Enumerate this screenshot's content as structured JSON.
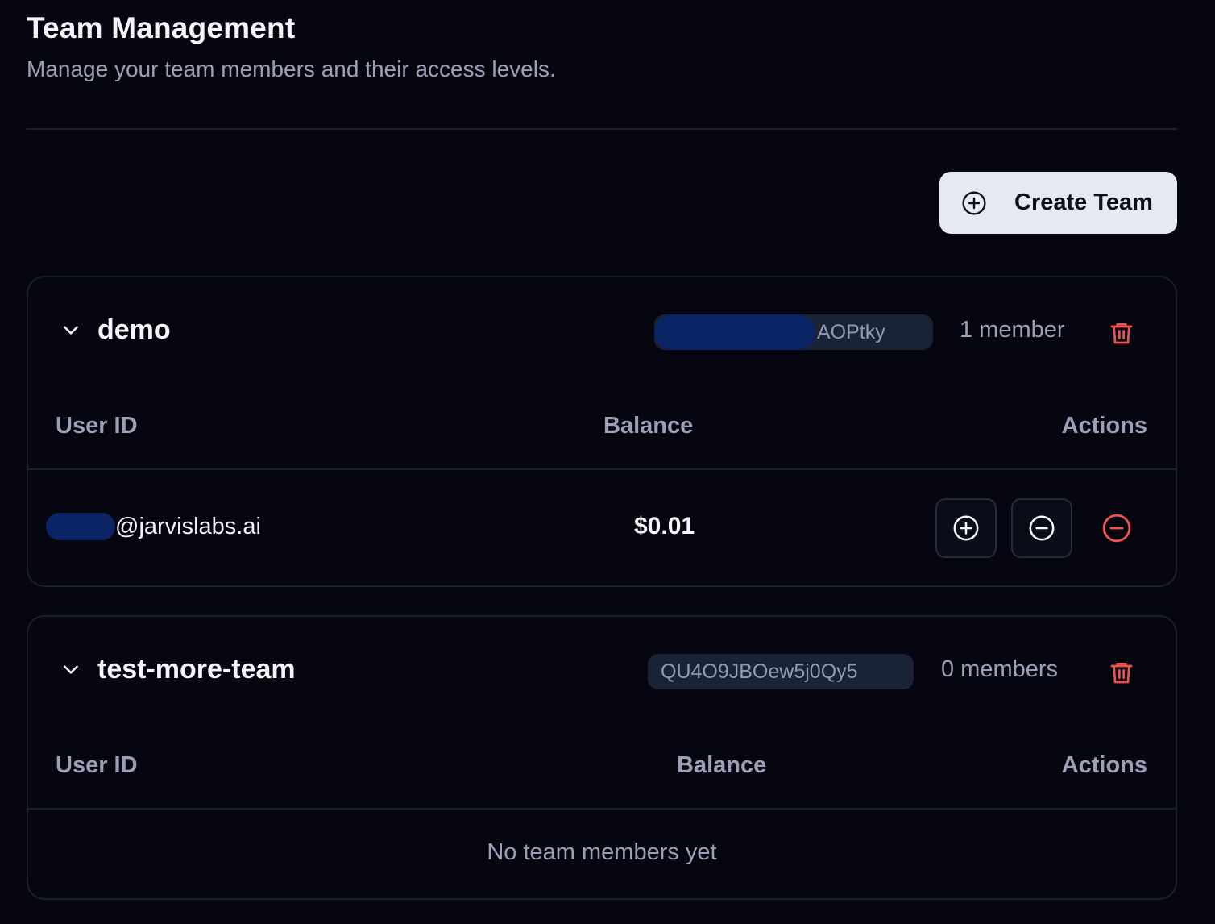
{
  "header": {
    "title": "Team Management",
    "subtitle": "Manage your team members and their access levels."
  },
  "toolbar": {
    "create_label": "Create Team"
  },
  "teams": [
    {
      "name": "demo",
      "id_visible": "AOPtky",
      "member_count": "1 member",
      "columns": [
        "User ID",
        "Balance",
        "Actions"
      ],
      "members": [
        {
          "user_id": "@jarvislabs.ai",
          "balance": "$0.01"
        }
      ]
    },
    {
      "name": "test-more-team",
      "id_visible": "QU4O9JBOew5j0Qy5",
      "member_count": "0 members",
      "columns": [
        "User ID",
        "Balance",
        "Actions"
      ],
      "empty_text": "No team members yet"
    }
  ],
  "colors": {
    "background": "#05060f",
    "danger": "#f0524f",
    "button_light": "#e6e8f2"
  }
}
